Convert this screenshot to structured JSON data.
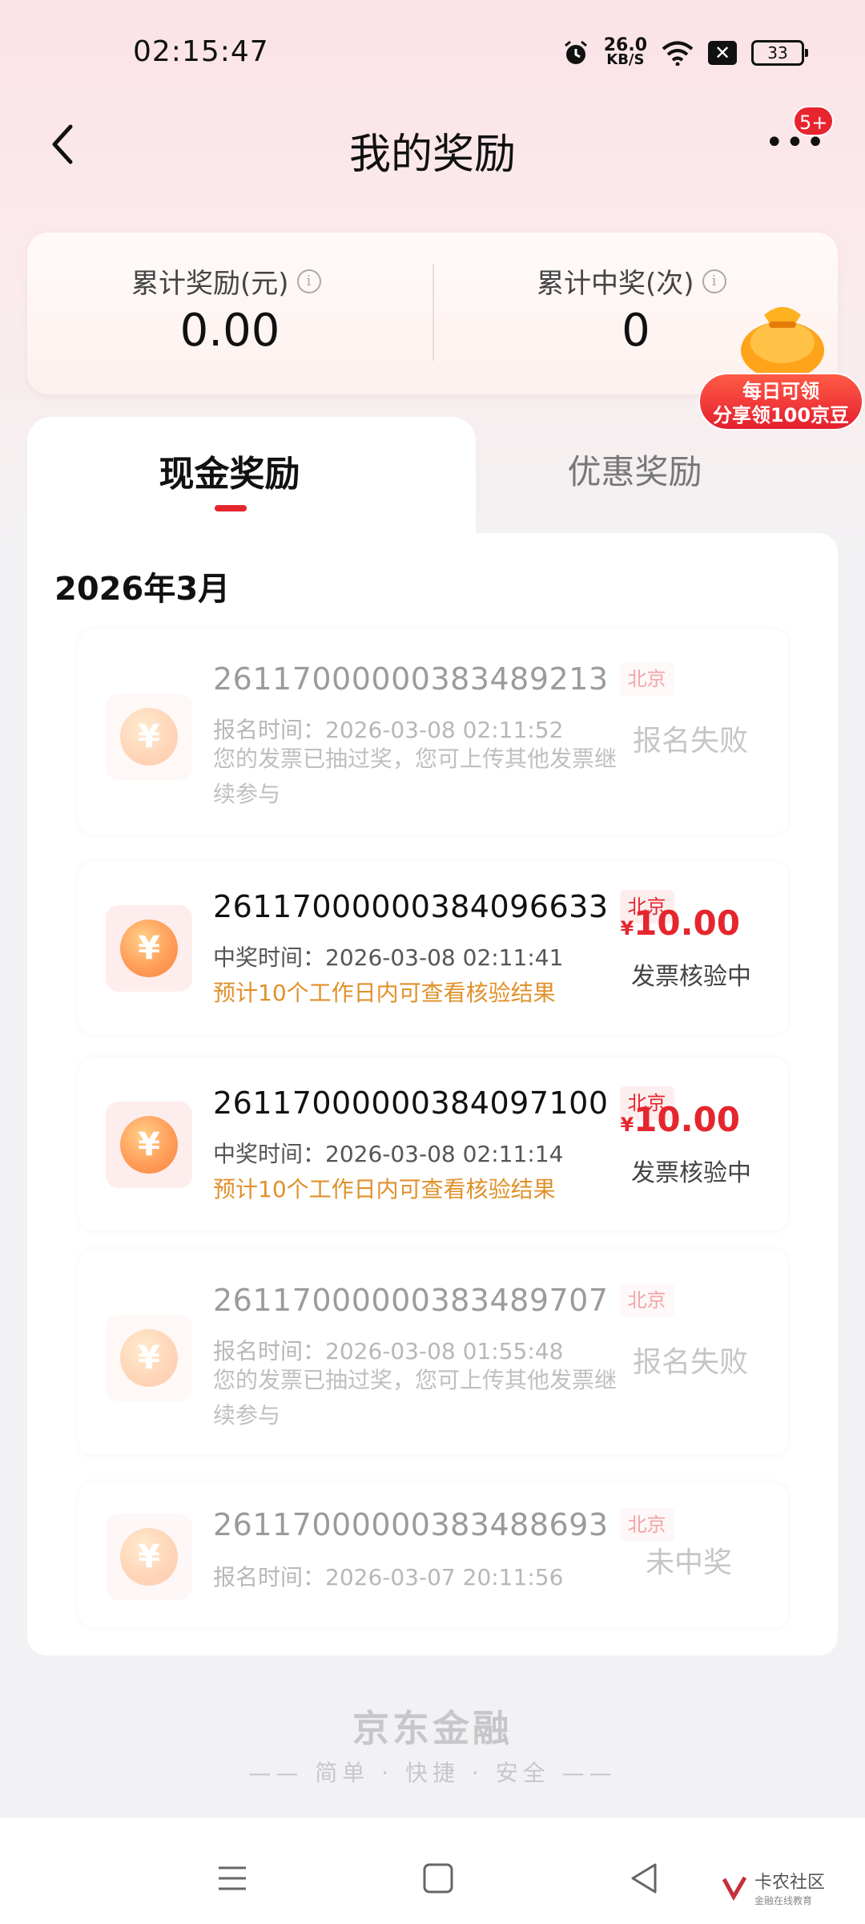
{
  "status_bar": {
    "time": "02:15:47",
    "net_speed": "26.0",
    "net_unit": "KB/S",
    "battery": "33"
  },
  "header": {
    "title": "我的奖励",
    "badge": "5+"
  },
  "summary": {
    "total_reward_label": "累计奖励(元)",
    "total_reward_value": "0.00",
    "total_wins_label": "累计中奖(次)",
    "total_wins_value": "0"
  },
  "promo": {
    "line1": "每日可领",
    "line2": "分享领100京豆"
  },
  "tabs": {
    "cash": "现金奖励",
    "coupon": "优惠奖励"
  },
  "month": "2026年3月",
  "records": [
    {
      "invoice": "26117000000383489213",
      "city": "北京",
      "time_label": "报名时间：2026-03-08 02:11:52",
      "note": "您的发票已抽过奖，您可上传其他发票继续参与",
      "status": "报名失败"
    },
    {
      "invoice": "26117000000384096633",
      "city": "北京",
      "time_label": "中奖时间：2026-03-08 02:11:41",
      "hint": "预计10个工作日内可查看核验结果",
      "currency": "¥",
      "amount": "10.00",
      "status": "发票核验中"
    },
    {
      "invoice": "26117000000384097100",
      "city": "北京",
      "time_label": "中奖时间：2026-03-08 02:11:14",
      "hint": "预计10个工作日内可查看核验结果",
      "currency": "¥",
      "amount": "10.00",
      "status": "发票核验中"
    },
    {
      "invoice": "26117000000383489707",
      "city": "北京",
      "time_label": "报名时间：2026-03-08 01:55:48",
      "note": "您的发票已抽过奖，您可上传其他发票继续参与",
      "status": "报名失败"
    },
    {
      "invoice": "26117000000383488693",
      "city": "北京",
      "time_label": "报名时间：2026-03-07 20:11:56",
      "status": "未中奖"
    }
  ],
  "footer": {
    "brand": "京东金融",
    "slogan": "简单 · 快捷 · 安全"
  },
  "watermark": {
    "name": "卡农社区",
    "sub": "金融在线教育"
  },
  "colors": {
    "accent_red": "#e5262e",
    "hint_orange": "#e0912b"
  },
  "icons": [
    "back-arrow-icon",
    "more-icon",
    "info-icon",
    "yuan-coin-icon",
    "menu-nav-icon",
    "home-nav-icon",
    "back-nav-icon"
  ]
}
